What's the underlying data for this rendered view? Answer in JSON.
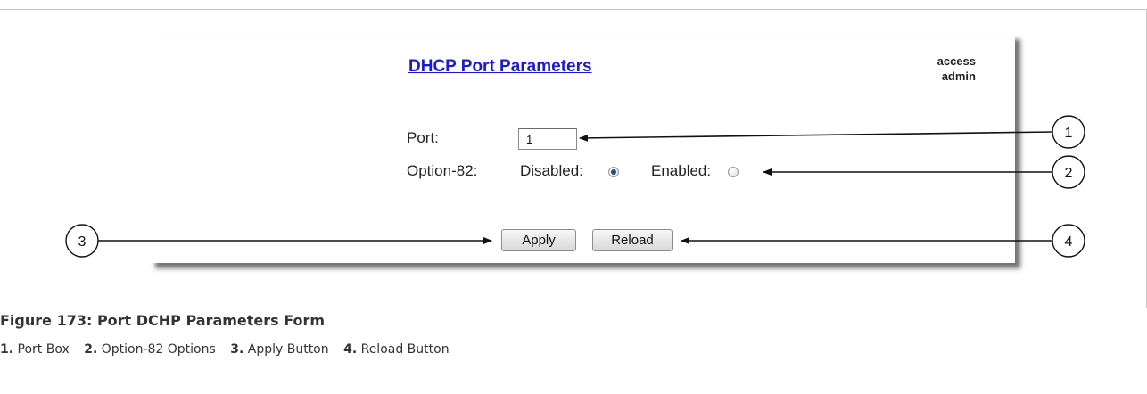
{
  "form": {
    "title": "DHCP Port Parameters",
    "access_label": "access",
    "access_user": "admin",
    "port_label": "Port:",
    "port_value": "1",
    "option82_label": "Option-82:",
    "disabled_label": "Disabled:",
    "enabled_label": "Enabled:",
    "option82_selected": "Disabled",
    "apply_label": "Apply",
    "reload_label": "Reload"
  },
  "callouts": [
    "1",
    "2",
    "3",
    "4"
  ],
  "figure": {
    "title": "Figure 173: Port DCHP Parameters Form",
    "legend": [
      {
        "num": "1.",
        "text": "Port Box"
      },
      {
        "num": "2.",
        "text": "Option-82 Options"
      },
      {
        "num": "3.",
        "text": "Apply Button"
      },
      {
        "num": "4.",
        "text": "Reload Button"
      }
    ]
  },
  "colors": {
    "title_link": "#1a1ad2",
    "text": "#222222",
    "caption": "#333333"
  }
}
